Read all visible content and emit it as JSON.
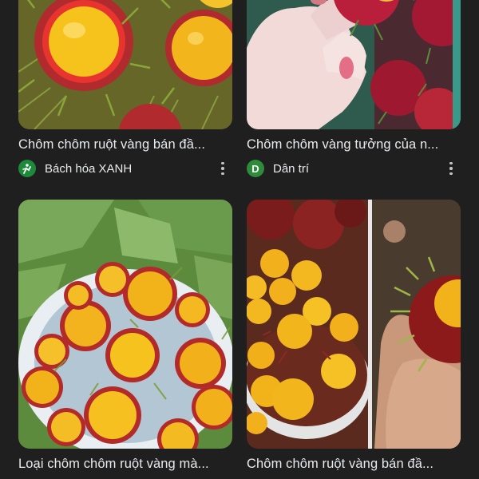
{
  "results": [
    {
      "title": "Chôm chôm ruột vàng bán đầ...",
      "source": "Bách hóa XANH",
      "favicon_icon": "bach-hoa-xanh-logo-icon",
      "favicon_color": "#1d8a3b"
    },
    {
      "title": "Chôm chôm vàng tưởng của n...",
      "source": "Dân trí",
      "favicon_icon": "dan-tri-logo-icon",
      "favicon_letter": "D",
      "favicon_color": "#2e8b3a"
    },
    {
      "title": "Loại chôm chôm ruột vàng mà...",
      "source": "",
      "favicon_icon": "source-logo-icon",
      "favicon_color": "#444"
    },
    {
      "title": "Chôm chôm ruột vàng bán đầ...",
      "source": "",
      "favicon_icon": "source-logo-icon",
      "favicon_color": "#444"
    }
  ],
  "colors": {
    "background": "#1f1f1f",
    "text": "#e8eaed",
    "fruit_yellow": "#f2b21a",
    "rind_red": "#b8232f",
    "spine_green": "#7c9a3a"
  }
}
